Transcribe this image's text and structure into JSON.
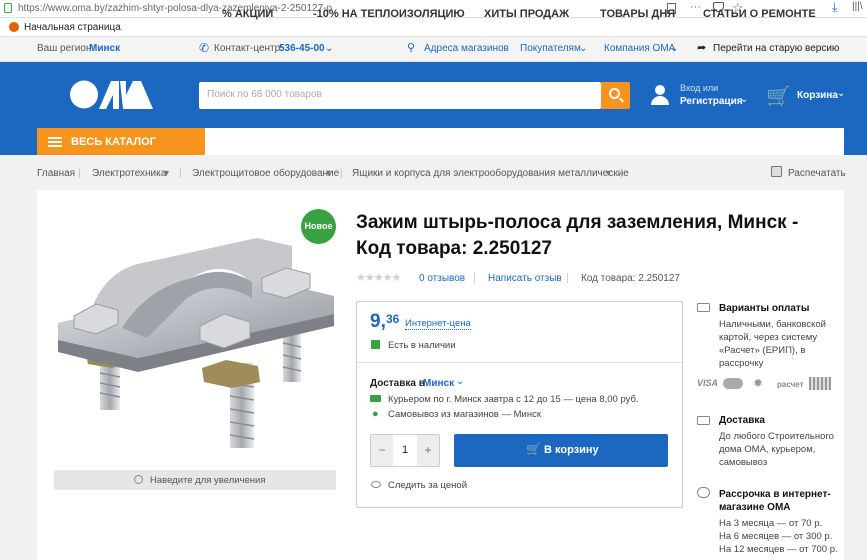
{
  "browser": {
    "url": "https://www.oma.by/zazhim-shtyr-polosa-dlya-zazemleniya-2-250127-p",
    "bookmark": "Начальная страница"
  },
  "topbar": {
    "region_label": "Ваш регион:",
    "region_value": "Минск",
    "contact_label": "Контакт-центр:",
    "contact_phone": "536-45-00",
    "stores": "Адреса магазинов",
    "buyers": "Покупателям",
    "company": "Компания ОМА",
    "old_version": "Перейти на старую версию"
  },
  "header": {
    "logo": "ОМА",
    "search_placeholder": "Поиск по 68 000 товаров",
    "login_small": "Вход или",
    "login_main": "Регистрация",
    "cart": "Корзина"
  },
  "nav": {
    "catalog": "ВЕСЬ КАТАЛОГ",
    "items": [
      "% АКЦИИ",
      "-10% НА ТЕПЛОИЗОЛЯЦИЮ",
      "ХИТЫ ПРОДАЖ",
      "ТОВАРЫ ДНЯ",
      "СТАТЬИ О РЕМОНТЕ"
    ]
  },
  "breadcrumbs": [
    "Главная",
    "Электротехника",
    "Электрощитовое оборудование",
    "Ящики и корпуса для электрооборудования металлические"
  ],
  "print": "Распечатать",
  "product": {
    "badge": "Новое",
    "title": "Зажим штырь-полоса для заземления, Минск - Код товара: 2.250127",
    "reviews": "0 отзывов",
    "write_review": "Написать отзыв",
    "code": "Код товара: 2.250127",
    "zoom_hint": "Наведите для увеличения",
    "rating": 0
  },
  "buy": {
    "price_int": "9,",
    "price_frac": "36",
    "price_label": "Интернет-цена",
    "stock": "Есть в наличии",
    "delivery_label": "Доставка в",
    "delivery_city": "Минск",
    "courier": "Курьером по г. Минск завтра с 12 до 15 — цена 8,00 руб.",
    "pickup": "Самовывоз из магазинов — Минск",
    "qty": "1",
    "minus": "−",
    "plus": "+",
    "cart_button": "В корзину",
    "watch": "Следить за ценой"
  },
  "side": {
    "payment_title": "Варианты оплаты",
    "payment_desc": "Наличными, банковской картой, через систему «Расчет» (ЕРИП), в рассрочку",
    "pay_icons": [
      "VISA",
      "MC",
      "belkart",
      "расчет",
      "ЕРИП"
    ],
    "delivery_title": "Доставка",
    "delivery_desc": "До любого Строительного дома ОМА, курьером, самовывоз",
    "install_title": "Рассрочка в интернет-магазине ОМА",
    "install_lines": [
      "На 3 месяца — от 70 р.",
      "На 6 месяцев — от 300 р.",
      "На 12 месяцев — от 700 р."
    ]
  }
}
